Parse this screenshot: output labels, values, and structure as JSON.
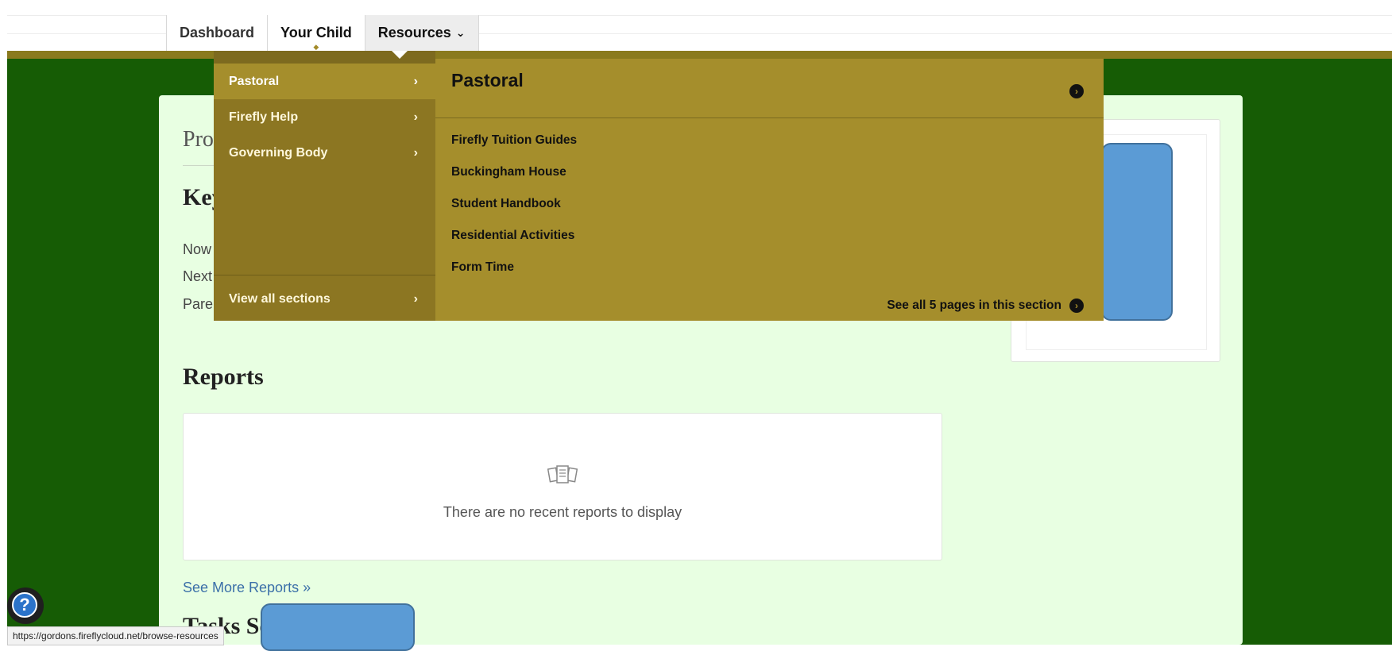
{
  "nav": {
    "tabs": [
      {
        "label": "Dashboard"
      },
      {
        "label": "Your Child"
      },
      {
        "label": "Resources"
      }
    ]
  },
  "main": {
    "profile_heading": "Pro",
    "key_heading": "Key",
    "key_lines": [
      "Now",
      "Next",
      "Paren"
    ],
    "reports_title": "Reports",
    "reports_empty": "There are no recent reports to display",
    "see_more": "See More Reports »",
    "tasks_heading": "Tasks Se"
  },
  "mega_menu": {
    "sections": [
      {
        "label": "Pastoral",
        "active": true
      },
      {
        "label": "Firefly Help"
      },
      {
        "label": "Governing Body"
      }
    ],
    "view_all": "View all sections",
    "panel_title": "Pastoral",
    "pages": [
      "Firefly Tuition Guides",
      "Buckingham House",
      "Student Handbook",
      "Residential Activities",
      "Form Time"
    ],
    "see_all": "See all 5 pages in this section"
  },
  "status_bar": {
    "url": "https://gordons.fireflycloud.net/browse-resources"
  },
  "icons": {
    "menu_arrow": "chevron-right-icon",
    "circle_arrow": "circle-arrow-right-icon",
    "help": "help-icon",
    "reports": "reports-icon"
  },
  "colors": {
    "brand_green": "#165c05",
    "menu_olive": "#a58e2c",
    "menu_olive_dark": "#8c7622",
    "panel_bg": "#e8ffe2",
    "link_blue": "#3a6fa8"
  }
}
